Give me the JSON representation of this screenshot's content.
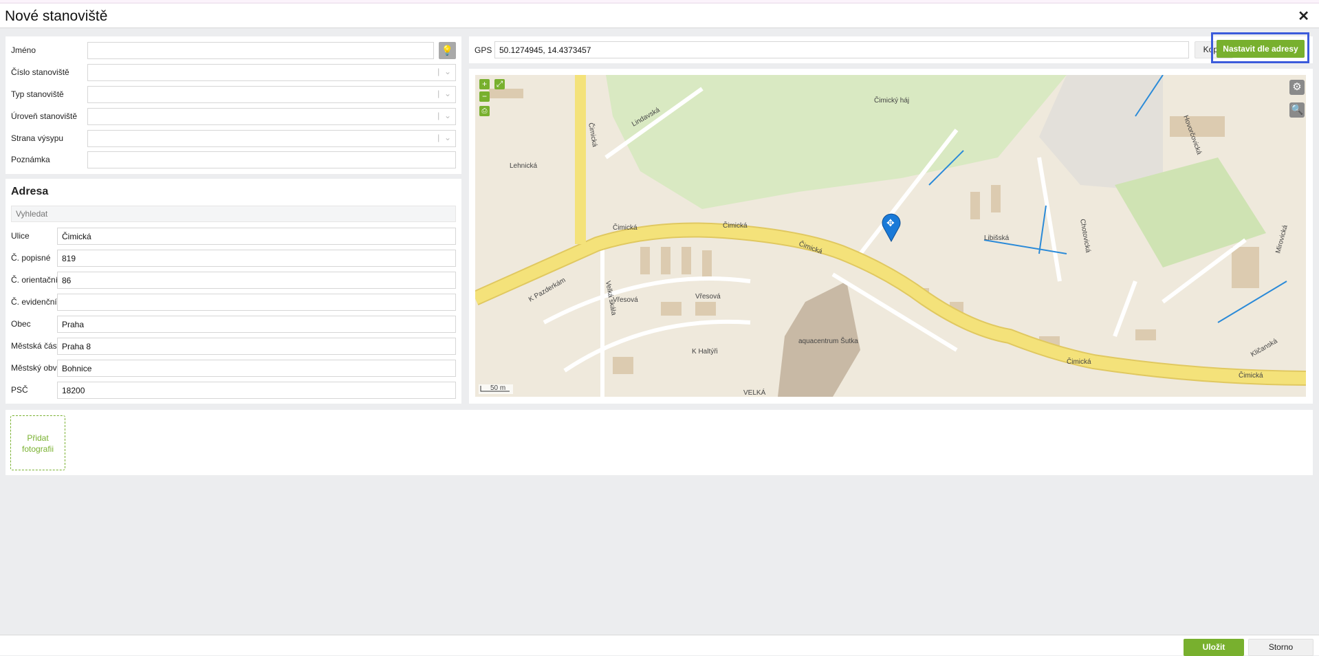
{
  "dialog": {
    "title": "Nové stanoviště"
  },
  "form": {
    "name": {
      "label": "Jméno",
      "value": ""
    },
    "number": {
      "label": "Číslo stanoviště",
      "value": ""
    },
    "type": {
      "label": "Typ stanoviště",
      "value": ""
    },
    "level": {
      "label": "Úroveň stanoviště",
      "value": ""
    },
    "side": {
      "label": "Strana výsypu",
      "value": ""
    },
    "note": {
      "label": "Poznámka",
      "value": ""
    }
  },
  "address": {
    "heading": "Adresa",
    "search_placeholder": "Vyhledat",
    "fields": [
      {
        "label": "Ulice",
        "value": "Čimická"
      },
      {
        "label": "Č. popisné",
        "value": "819"
      },
      {
        "label": "Č. orientační",
        "value": "86"
      },
      {
        "label": "Č. evidenční",
        "value": ""
      },
      {
        "label": "Obec",
        "value": "Praha"
      },
      {
        "label": "Městská část",
        "value": "Praha 8"
      },
      {
        "label": "Městský obvod",
        "value": "Bohnice"
      },
      {
        "label": "PSČ",
        "value": "18200"
      }
    ]
  },
  "photos": {
    "add_label_1": "Přidat",
    "add_label_2": "fotografii"
  },
  "gps": {
    "label": "GPS",
    "value": "50.1274945, 14.4373457",
    "copy_label": "Kopie",
    "set_by_address_label": "Nastavit dle adresy"
  },
  "map": {
    "labels": {
      "cimicka": "Čimická",
      "pazderkam": "K Pazderkám",
      "velka_skala": "Velká skála",
      "vresova": "Vřesová",
      "haltyri": "K Haltýři",
      "libisska": "Libišská",
      "chotovicka": "Chotovická",
      "mirovicka": "Mirovická",
      "klicanska": "Kličanská",
      "lindavska": "Lindavská",
      "haj": "Čimický háj",
      "aquacentrum": "aquacentrum Šutka",
      "hovorcovicka": "Hovorčovická",
      "lehnicka": "Lehnická",
      "velka": "VELKÁ"
    },
    "scale": "50 m",
    "colors": {
      "land": "#efe9dc",
      "park": "#d9e9c2",
      "road": "#f4e27a",
      "building": "#dccbb0"
    }
  },
  "footer": {
    "save_label": "Uložit",
    "cancel_label": "Storno"
  },
  "colors": {
    "accent": "#78b02e",
    "highlight": "#3b5bdb"
  }
}
